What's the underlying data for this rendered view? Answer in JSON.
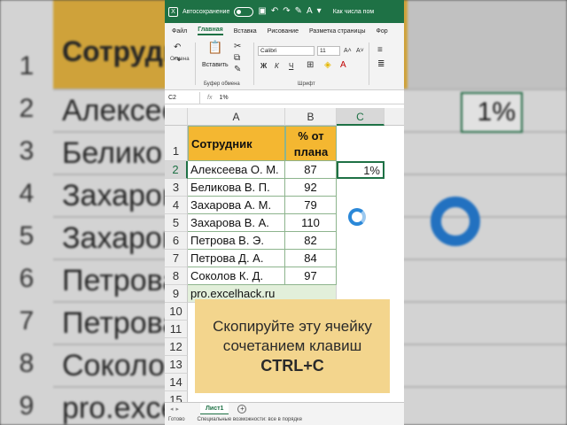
{
  "title_bar": {
    "autosave_label": "Автосохранение",
    "document_title": "Как числа пом"
  },
  "ribbon_tabs": [
    "Файл",
    "Главная",
    "Вставка",
    "Рисование",
    "Разметка страницы",
    "Фор"
  ],
  "ribbon": {
    "undo_group_label": "Отмена",
    "paste_label": "Вставить",
    "clipboard_group_label": "Буфер обмена",
    "font_name": "Calibri",
    "font_size": "11",
    "font_group_label": "Шрифт",
    "bold": "Ж",
    "italic": "К",
    "underline": "Ч"
  },
  "formula_bar": {
    "name_box": "C2",
    "formula": "1%"
  },
  "columns": [
    "A",
    "B",
    "C"
  ],
  "selected_column": "C",
  "selected_row": "2",
  "table": {
    "header_name": "Сотрудник",
    "header_value": "% от плана",
    "rows": [
      {
        "row": "2",
        "name": "Алексеева О. М.",
        "value": "87"
      },
      {
        "row": "3",
        "name": "Беликова В. П.",
        "value": "92"
      },
      {
        "row": "4",
        "name": "Захарова А. М.",
        "value": "79"
      },
      {
        "row": "5",
        "name": "Захарова В. А.",
        "value": "110"
      },
      {
        "row": "6",
        "name": "Петрова В. Э.",
        "value": "82"
      },
      {
        "row": "7",
        "name": "Петрова Д. А.",
        "value": "84"
      },
      {
        "row": "8",
        "name": "Соколов К. Д.",
        "value": "97"
      }
    ],
    "footer": "pro.excelhack.ru"
  },
  "empty_rows": [
    "10",
    "11",
    "12",
    "13",
    "14",
    "15"
  ],
  "selected_cell_value": "1%",
  "callout": {
    "line1": "Скопируйте эту ячейку",
    "line2": "сочетанием клавиш",
    "shortcut": "CTRL+C"
  },
  "sheet_tab": "Лист1",
  "status": {
    "ready": "Готово",
    "accessibility": "Специальные возможности: все в порядке"
  },
  "background_zoom": {
    "header": "Сотрудн",
    "rows": [
      {
        "num": "1",
        "name": ""
      },
      {
        "num": "2",
        "name": "Алексеева"
      },
      {
        "num": "3",
        "name": "Белико"
      },
      {
        "num": "4",
        "name": "Захарова"
      },
      {
        "num": "5",
        "name": "Захарова"
      },
      {
        "num": "6",
        "name": "Петрова"
      },
      {
        "num": "7",
        "name": "Петрова"
      },
      {
        "num": "8",
        "name": "Соколо"
      },
      {
        "num": "9",
        "name": "pro.excel"
      }
    ],
    "pct": "1%"
  },
  "colors": {
    "excel_green": "#1e7145",
    "header_fill": "#f4b731",
    "footer_fill": "#e2efda",
    "callout_fill": "#f3d58d"
  }
}
